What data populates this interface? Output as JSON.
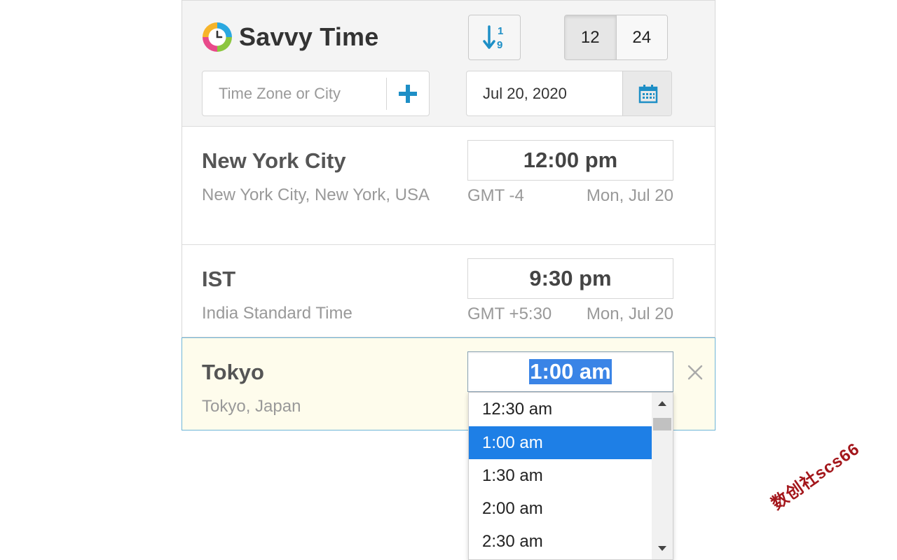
{
  "app": {
    "title": "Savvy Time"
  },
  "toolbar": {
    "format_12_label": "12",
    "format_24_label": "24",
    "search_placeholder": "Time Zone or City",
    "date_value": "Jul 20, 2020"
  },
  "zones": [
    {
      "name": "New York City",
      "subtitle": "New York City, New York, USA",
      "time": "12:00 pm",
      "gmt": "GMT -4",
      "date": "Mon, Jul 20"
    },
    {
      "name": "IST",
      "subtitle": "India Standard Time",
      "time": "9:30 pm",
      "gmt": "GMT +5:30",
      "date": "Mon, Jul 20"
    },
    {
      "name": "Tokyo",
      "subtitle": "Tokyo, Japan",
      "time": "1:00 am"
    }
  ],
  "dropdown": {
    "options": [
      "12:30 am",
      "1:00 am",
      "1:30 am",
      "2:00 am",
      "2:30 am"
    ],
    "selected": "1:00 am"
  },
  "watermark": "数创社scs66",
  "colors": {
    "accent": "#1e8fc6",
    "selected": "#1e7fe6",
    "highlight_row": "#fefcec"
  }
}
